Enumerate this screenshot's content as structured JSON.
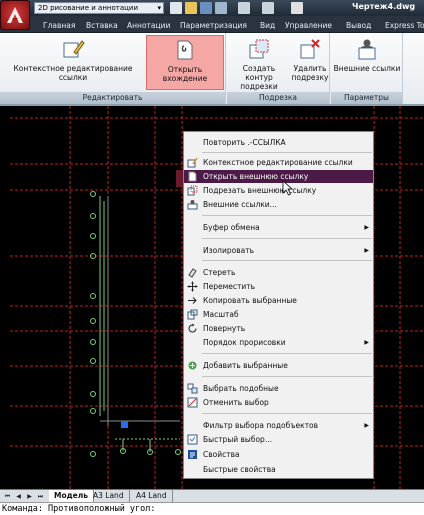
{
  "titlebar": {
    "workspace": "2D рисование и аннотации",
    "document_title": "Чертеж4.dwg"
  },
  "ribbon_tabs": [
    "Главная",
    "Вставка",
    "Аннотации",
    "Параметризация",
    "Вид",
    "Управление",
    "Вывод",
    "Express To"
  ],
  "ribbon": {
    "panels": [
      {
        "title": "Редактировать",
        "buttons": [
          "Контекстное редактирование ссылки",
          "Открыть вхождение"
        ]
      },
      {
        "title": "Подрезка",
        "buttons": [
          "Создать контур подрезки",
          "Удалить подрезку"
        ]
      },
      {
        "title": "Параметры",
        "buttons": [
          "Внешние ссылки"
        ]
      }
    ]
  },
  "context_menu": {
    "items": [
      {
        "label": "Повторить .-ССЫЛКА",
        "icon": "",
        "submenu": false
      },
      {
        "label": "Контекстное редактирование ссылки",
        "icon": "edit-ref-icon",
        "submenu": false
      },
      {
        "label": "Открыть внешнюю ссылку",
        "icon": "open-xref-icon",
        "submenu": false,
        "highlighted": true
      },
      {
        "label": "Подрезать внешнюю ссылку",
        "icon": "clip-xref-icon",
        "submenu": false
      },
      {
        "label": "Внешние ссылки...",
        "icon": "xrefs-icon",
        "submenu": false
      },
      {
        "label": "Буфер обмена",
        "icon": "",
        "submenu": true
      },
      {
        "label": "Изолировать",
        "icon": "",
        "submenu": true
      },
      {
        "label": "Стереть",
        "icon": "erase-icon",
        "submenu": false
      },
      {
        "label": "Переместить",
        "icon": "move-icon",
        "submenu": false
      },
      {
        "label": "Копировать выбранные",
        "icon": "copy-icon",
        "submenu": false
      },
      {
        "label": "Масштаб",
        "icon": "scale-icon",
        "submenu": false
      },
      {
        "label": "Повернуть",
        "icon": "rotate-icon",
        "submenu": false
      },
      {
        "label": "Порядок прорисовки",
        "icon": "",
        "submenu": true
      },
      {
        "label": "Добавить выбранные",
        "icon": "add-selected-icon",
        "submenu": false
      },
      {
        "label": "Выбрать подобные",
        "icon": "select-similar-icon",
        "submenu": false
      },
      {
        "label": "Отменить выбор",
        "icon": "deselect-icon",
        "submenu": false
      },
      {
        "label": "Фильтр выбора подобъектов",
        "icon": "",
        "submenu": true
      },
      {
        "label": "Быстрый выбор...",
        "icon": "quick-select-icon",
        "submenu": false
      },
      {
        "label": "Свойства",
        "icon": "properties-icon",
        "submenu": false
      },
      {
        "label": "Быстрые свойства",
        "icon": "",
        "submenu": false
      }
    ]
  },
  "layout_tabs": [
    "Модель",
    "A3 Land",
    "A4 Land"
  ],
  "command_line": "Команда: Противоположный угол:",
  "colors": {
    "highlight": "#4b1a46",
    "ribbon_active_button": "#f4a7a5",
    "grid_lines": "#c02020",
    "geometry": "#7ad07a"
  }
}
